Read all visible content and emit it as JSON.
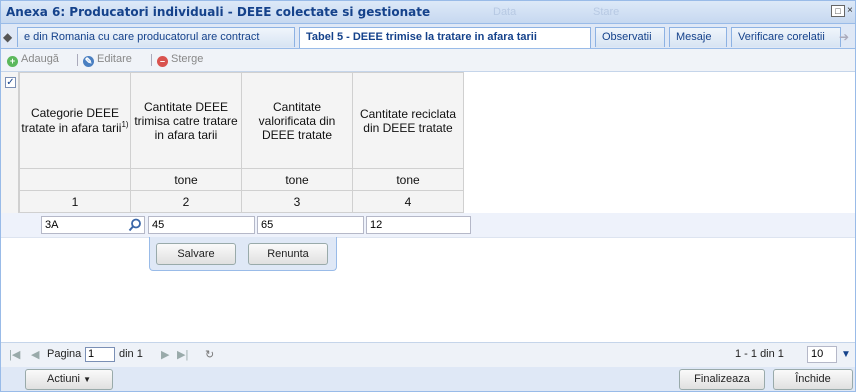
{
  "window": {
    "title": "Anexa 6: Producatori individuali - DEEE colectate si gestionate",
    "ghost_data": "Data",
    "ghost_stare": "Stare"
  },
  "tabs": [
    {
      "label": "e din Romania cu care producatorul are contract",
      "active": false
    },
    {
      "label": "Tabel 5 - DEEE trimise la tratare in afara tarii",
      "active": true
    },
    {
      "label": "Observatii",
      "active": false
    },
    {
      "label": "Mesaje",
      "active": false
    },
    {
      "label": "Verificare corelatii",
      "active": false
    }
  ],
  "toolbar": {
    "add_label": "Adaugă",
    "edit_label": "Editare",
    "delete_label": "Sterge"
  },
  "grid": {
    "headers": [
      {
        "label": "Categorie DEEE tratate in afara tarii",
        "sup": "1)"
      },
      {
        "label": "Cantitate DEEE trimisa catre tratare in afara tarii"
      },
      {
        "label": "Cantitate valorificata din DEEE tratate"
      },
      {
        "label": "Cantitate reciclata din DEEE tratate"
      }
    ],
    "units": [
      "",
      "tone",
      "tone",
      "tone"
    ],
    "numbers": [
      "1",
      "2",
      "3",
      "4"
    ],
    "edit_row": {
      "category": "3A",
      "col2": "45",
      "col3": "65",
      "col4": "12"
    },
    "save_label": "Salvare",
    "cancel_label": "Renunta"
  },
  "pager": {
    "page_label": "Pagina",
    "page_value": "1",
    "of_label": "din 1",
    "summary": "1 - 1 din 1",
    "page_size": "10"
  },
  "bottom": {
    "actions_label": "Actiuni",
    "finalize_label": "Finalizeaza",
    "close_label": "Închide"
  }
}
